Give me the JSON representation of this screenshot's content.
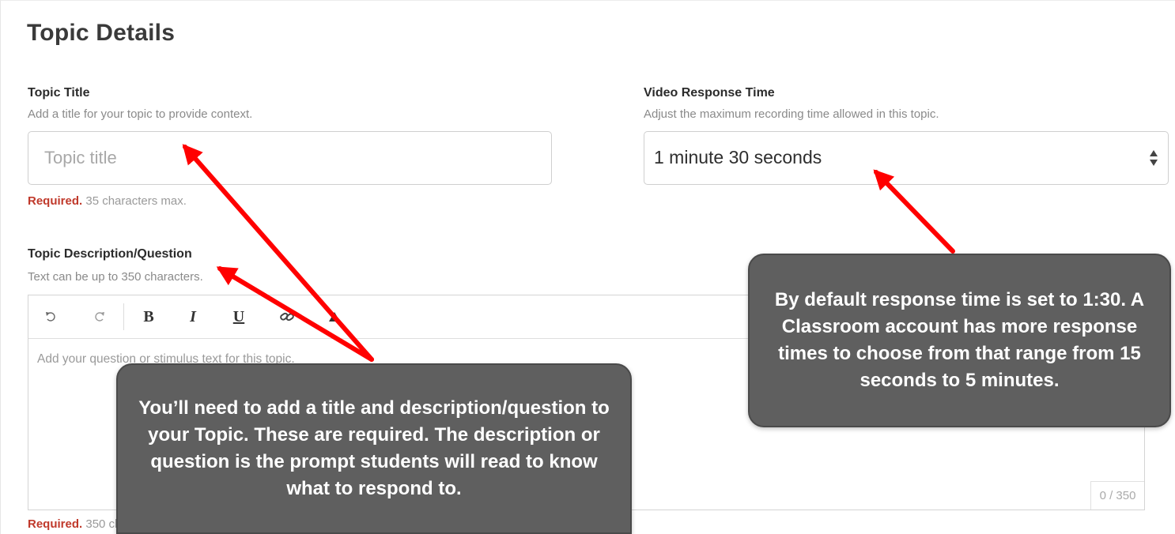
{
  "page": {
    "title": "Topic Details"
  },
  "topic_title": {
    "label": "Topic Title",
    "help": "Add a title for your topic to provide context.",
    "placeholder": "Topic title",
    "value": "",
    "required_label": "Required.",
    "required_note": "35 characters max."
  },
  "video_response": {
    "label": "Video Response Time",
    "help": "Adjust the maximum recording time allowed in this topic.",
    "selected": "1 minute 30 seconds",
    "icon": "updown-arrows-icon"
  },
  "description": {
    "label": "Topic Description/Question",
    "help": "Text can be up to 350 characters.",
    "placeholder": "Add your question or stimulus text for this topic.",
    "counter": "0 / 350",
    "required_label": "Required.",
    "required_note": "350 characters max.",
    "toolbar": {
      "undo_icon": "undo-icon",
      "redo_icon": "redo-icon",
      "bold": "B",
      "italic": "I",
      "underline": "U",
      "link_icon": "link-icon",
      "clear_format_icon": "eraser-icon"
    }
  },
  "callouts": {
    "left": "You’ll need to add a title and description/question to your Topic. These are required. The description or question is the prompt students will read to know what to respond to.",
    "right": "By default response time is set to 1:30. A Classroom account has more response times to choose from that range from 15 seconds to 5 minutes."
  },
  "colors": {
    "required": "#c0392b",
    "callout_bg": "#5f5f5f",
    "arrow": "#ff0000"
  }
}
